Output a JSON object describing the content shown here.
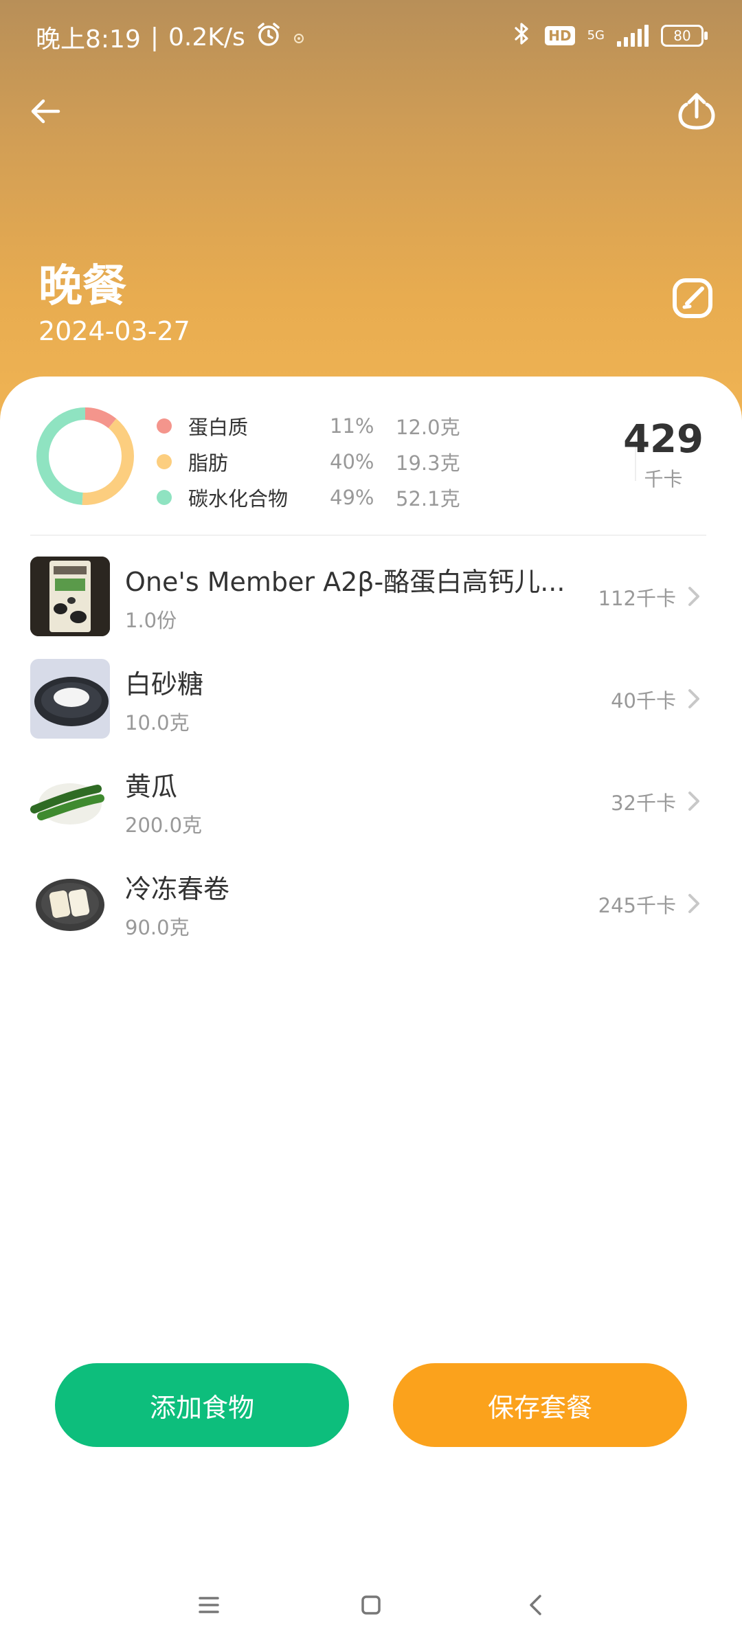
{
  "status_bar": {
    "time": "晚上8:19",
    "network_speed": "0.2K/s",
    "hd": "HD",
    "network_type": "5G",
    "battery": "80"
  },
  "header": {
    "meal_title": "晚餐",
    "date": "2024-03-27"
  },
  "nutrition": {
    "total_kcal": "429",
    "kcal_unit": "千卡",
    "macros": [
      {
        "name": "蛋白质",
        "percent": "11%",
        "amount": "12.0克",
        "color": "#f4958c",
        "fraction": 0.11
      },
      {
        "name": "脂肪",
        "percent": "40%",
        "amount": "19.3克",
        "color": "#fcce7f",
        "fraction": 0.4
      },
      {
        "name": "碳水化合物",
        "percent": "49%",
        "amount": "52.1克",
        "color": "#8fe3c1",
        "fraction": 0.49
      }
    ]
  },
  "foods": [
    {
      "name": "One's  Member A2β-酪蛋白高钙儿...",
      "amount": "1.0份",
      "kcal": "112千卡"
    },
    {
      "name": "白砂糖",
      "amount": "10.0克",
      "kcal": "40千卡"
    },
    {
      "name": "黄瓜",
      "amount": "200.0克",
      "kcal": "32千卡"
    },
    {
      "name": "冷冻春卷",
      "amount": "90.0克",
      "kcal": "245千卡"
    }
  ],
  "actions": {
    "add_food": "添加食物",
    "save_meal": "保存套餐"
  },
  "colors": {
    "header_top": "#b88f58",
    "header_bottom": "#f0b454",
    "add_button": "#0dbe7c",
    "save_button": "#fba21c"
  }
}
